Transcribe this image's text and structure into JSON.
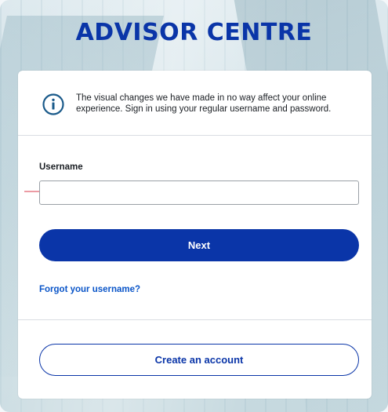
{
  "brand": {
    "title": "ADVISOR CENTRE"
  },
  "notice": {
    "icon": "info-icon",
    "text": "The visual changes we have made in no way affect your online experience. Sign in using your regular username and password."
  },
  "form": {
    "username_label": "Username",
    "username_value": "",
    "username_placeholder": "",
    "next_label": "Next",
    "forgot_label": "Forgot your username?",
    "create_label": "Create an account"
  },
  "annotation": {
    "icon": "arrow-right-icon",
    "color": "#e57a86"
  },
  "colors": {
    "brand": "#0a35a8",
    "link": "#0a55c8",
    "info_icon": "#1a5a8a"
  }
}
